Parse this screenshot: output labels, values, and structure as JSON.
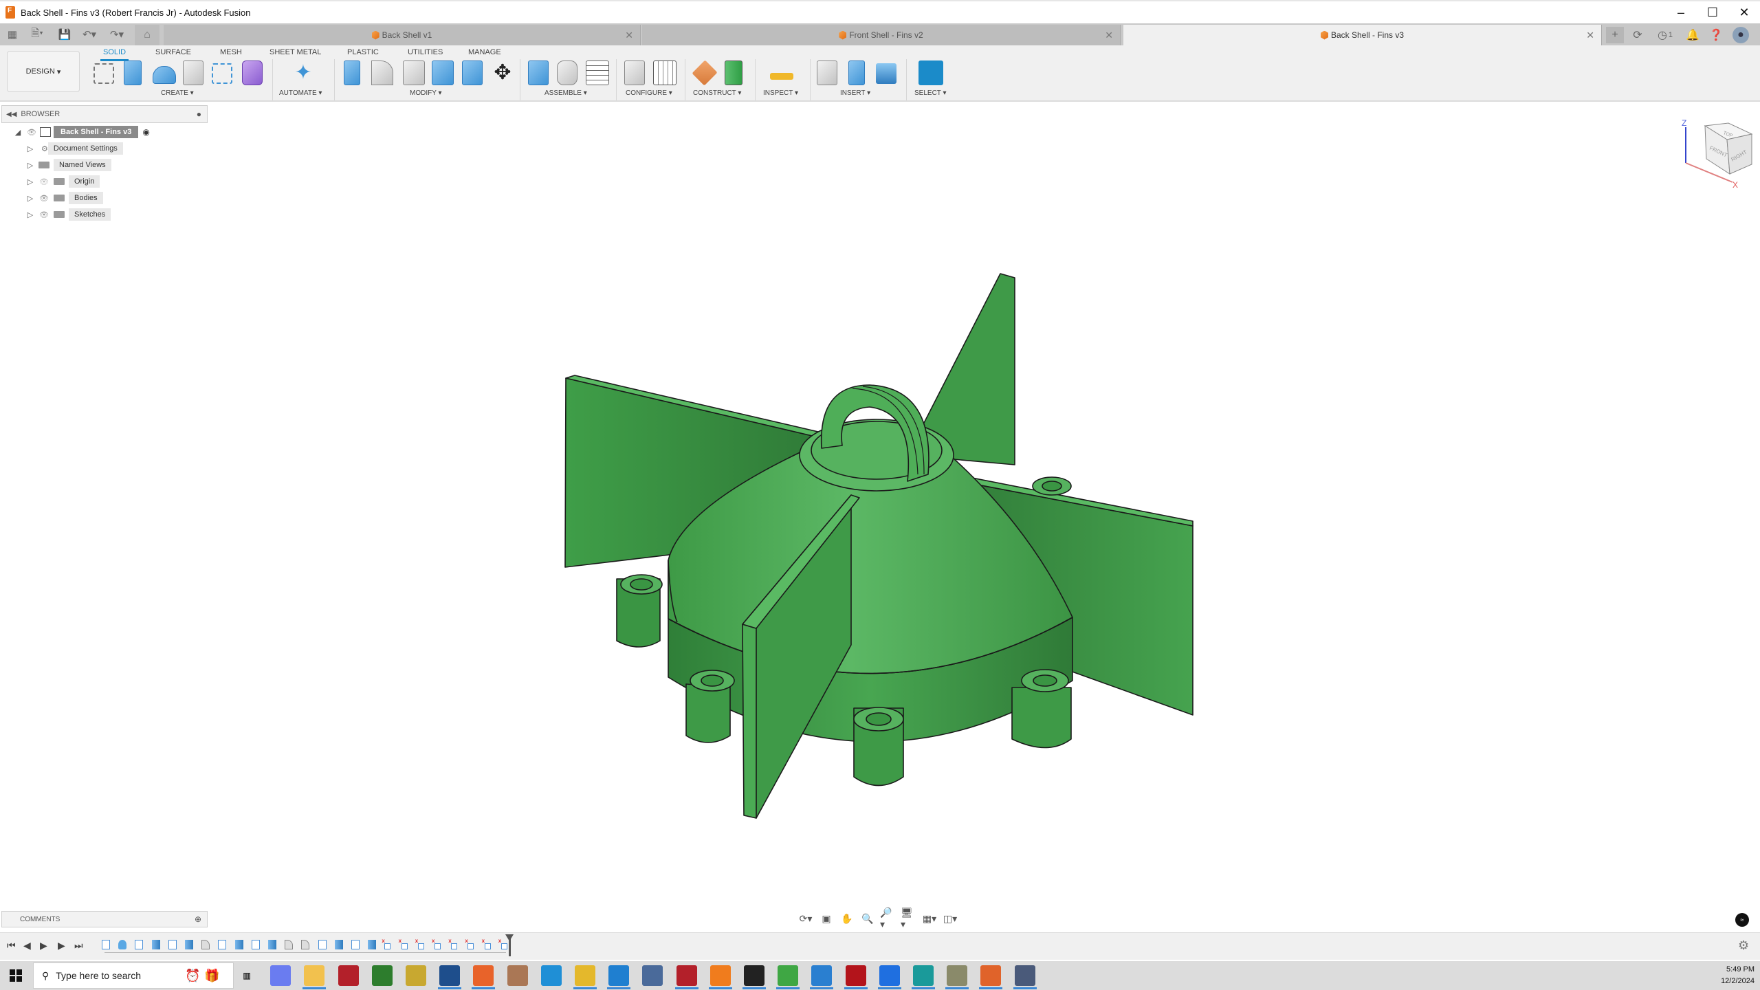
{
  "window": {
    "title": "Back Shell - Fins v3 (Robert Francis Jr) - Autodesk Fusion",
    "controls": [
      "minimize",
      "maximize",
      "close"
    ]
  },
  "tabs": [
    {
      "label": "Back Shell v1",
      "active": false
    },
    {
      "label": "Front Shell - Fins v2",
      "active": false
    },
    {
      "label": "Back Shell - Fins v3",
      "active": true
    }
  ],
  "tabbar_right": {
    "job_count": "1"
  },
  "toolbar": {
    "workspace": "DESIGN",
    "workspace_tabs": [
      "SOLID",
      "SURFACE",
      "MESH",
      "SHEET METAL",
      "PLASTIC",
      "UTILITIES",
      "MANAGE"
    ],
    "active_workspace_tab": "SOLID",
    "groups": [
      {
        "label": "CREATE",
        "tools": [
          "create-sketch",
          "extrude",
          "revolve",
          "hole",
          "pattern",
          "create-form"
        ]
      },
      {
        "label": "AUTOMATE",
        "tools": [
          "automate"
        ]
      },
      {
        "label": "MODIFY",
        "tools": [
          "press-pull",
          "fillet",
          "shell",
          "combine",
          "split-face",
          "move-copy"
        ]
      },
      {
        "label": "ASSEMBLE",
        "tools": [
          "new-component",
          "joint",
          "bill-of-materials"
        ]
      },
      {
        "label": "CONFIGURE",
        "tools": [
          "configure-model",
          "configuration-table"
        ]
      },
      {
        "label": "CONSTRUCT",
        "tools": [
          "plane-at-angle",
          "midplane"
        ]
      },
      {
        "label": "INSPECT",
        "tools": [
          "measure"
        ]
      },
      {
        "label": "INSERT",
        "tools": [
          "insert-derive",
          "insert-mcmaster",
          "insert-canvas"
        ]
      },
      {
        "label": "SELECT",
        "tools": [
          "select"
        ]
      }
    ]
  },
  "browser": {
    "title": "BROWSER",
    "root": "Back Shell - Fins v3",
    "items": [
      {
        "label": "Document Settings",
        "icon": "gear-icon",
        "visible": null
      },
      {
        "label": "Named Views",
        "icon": "folder-icon",
        "visible": null
      },
      {
        "label": "Origin",
        "icon": "folder-icon",
        "visible": false
      },
      {
        "label": "Bodies",
        "icon": "folder-icon",
        "visible": true
      },
      {
        "label": "Sketches",
        "icon": "folder-icon",
        "visible": true
      }
    ]
  },
  "viewcube": {
    "faces": [
      "TOP",
      "FRONT",
      "RIGHT"
    ],
    "axes": [
      "Z",
      "X"
    ]
  },
  "model": {
    "color": "#4caf50",
    "edge_color": "#1a1a1a"
  },
  "comments": {
    "title": "COMMENTS"
  },
  "timeline": {
    "items": [
      "sketch",
      "sweep",
      "sketch",
      "extrude",
      "sketch",
      "extrude",
      "fillet",
      "sketch",
      "extrude",
      "sketch",
      "extrude",
      "fillet",
      "fillet",
      "sketch",
      "extrude",
      "sketch",
      "extrude",
      "joint-origin",
      "joint-origin",
      "joint-origin",
      "joint-origin",
      "joint-origin",
      "joint-origin",
      "joint-origin",
      "joint-origin"
    ]
  },
  "taskbar": {
    "search_placeholder": "Type here to search",
    "apps": [
      "task-view",
      "copilot",
      "file-explorer",
      "es-explorer",
      "app-55",
      "app-feather",
      "virtualbox",
      "firefox",
      "app-misc",
      "edge",
      "chrome",
      "vscode",
      "network",
      "filezilla",
      "fusion",
      "cinema4d",
      "libreoffice-calc",
      "libreoffice-writer",
      "acrobat",
      "app-c",
      "arduino",
      "gimp",
      "libreoffice-impress",
      "calculator"
    ],
    "time": "5:49 PM",
    "date": "12/2/2024"
  }
}
